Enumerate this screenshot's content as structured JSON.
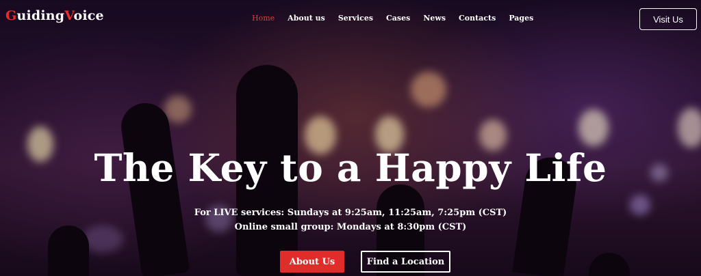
{
  "brand": {
    "first_letter": "G",
    "part1": "uiding",
    "accent_letter": "V",
    "part2": "oice"
  },
  "nav": {
    "items": [
      {
        "label": "Home",
        "active": true
      },
      {
        "label": "About us"
      },
      {
        "label": "Services"
      },
      {
        "label": "Cases"
      },
      {
        "label": "News"
      },
      {
        "label": "Contacts"
      },
      {
        "label": "Pages"
      }
    ]
  },
  "header": {
    "visit_button": "Visit Us"
  },
  "hero": {
    "title": "The Key to a Happy Life",
    "line1": "For LIVE services: Sundays at 9:25am, 11:25am, 7:25pm (CST)",
    "line2": "Online small group: Mondays at 8:30pm (CST)",
    "primary_button": "About Us",
    "secondary_button": "Find a Location"
  },
  "colors": {
    "accent": "#e12c2c",
    "text": "#ffffff",
    "background": "#2a1232"
  }
}
